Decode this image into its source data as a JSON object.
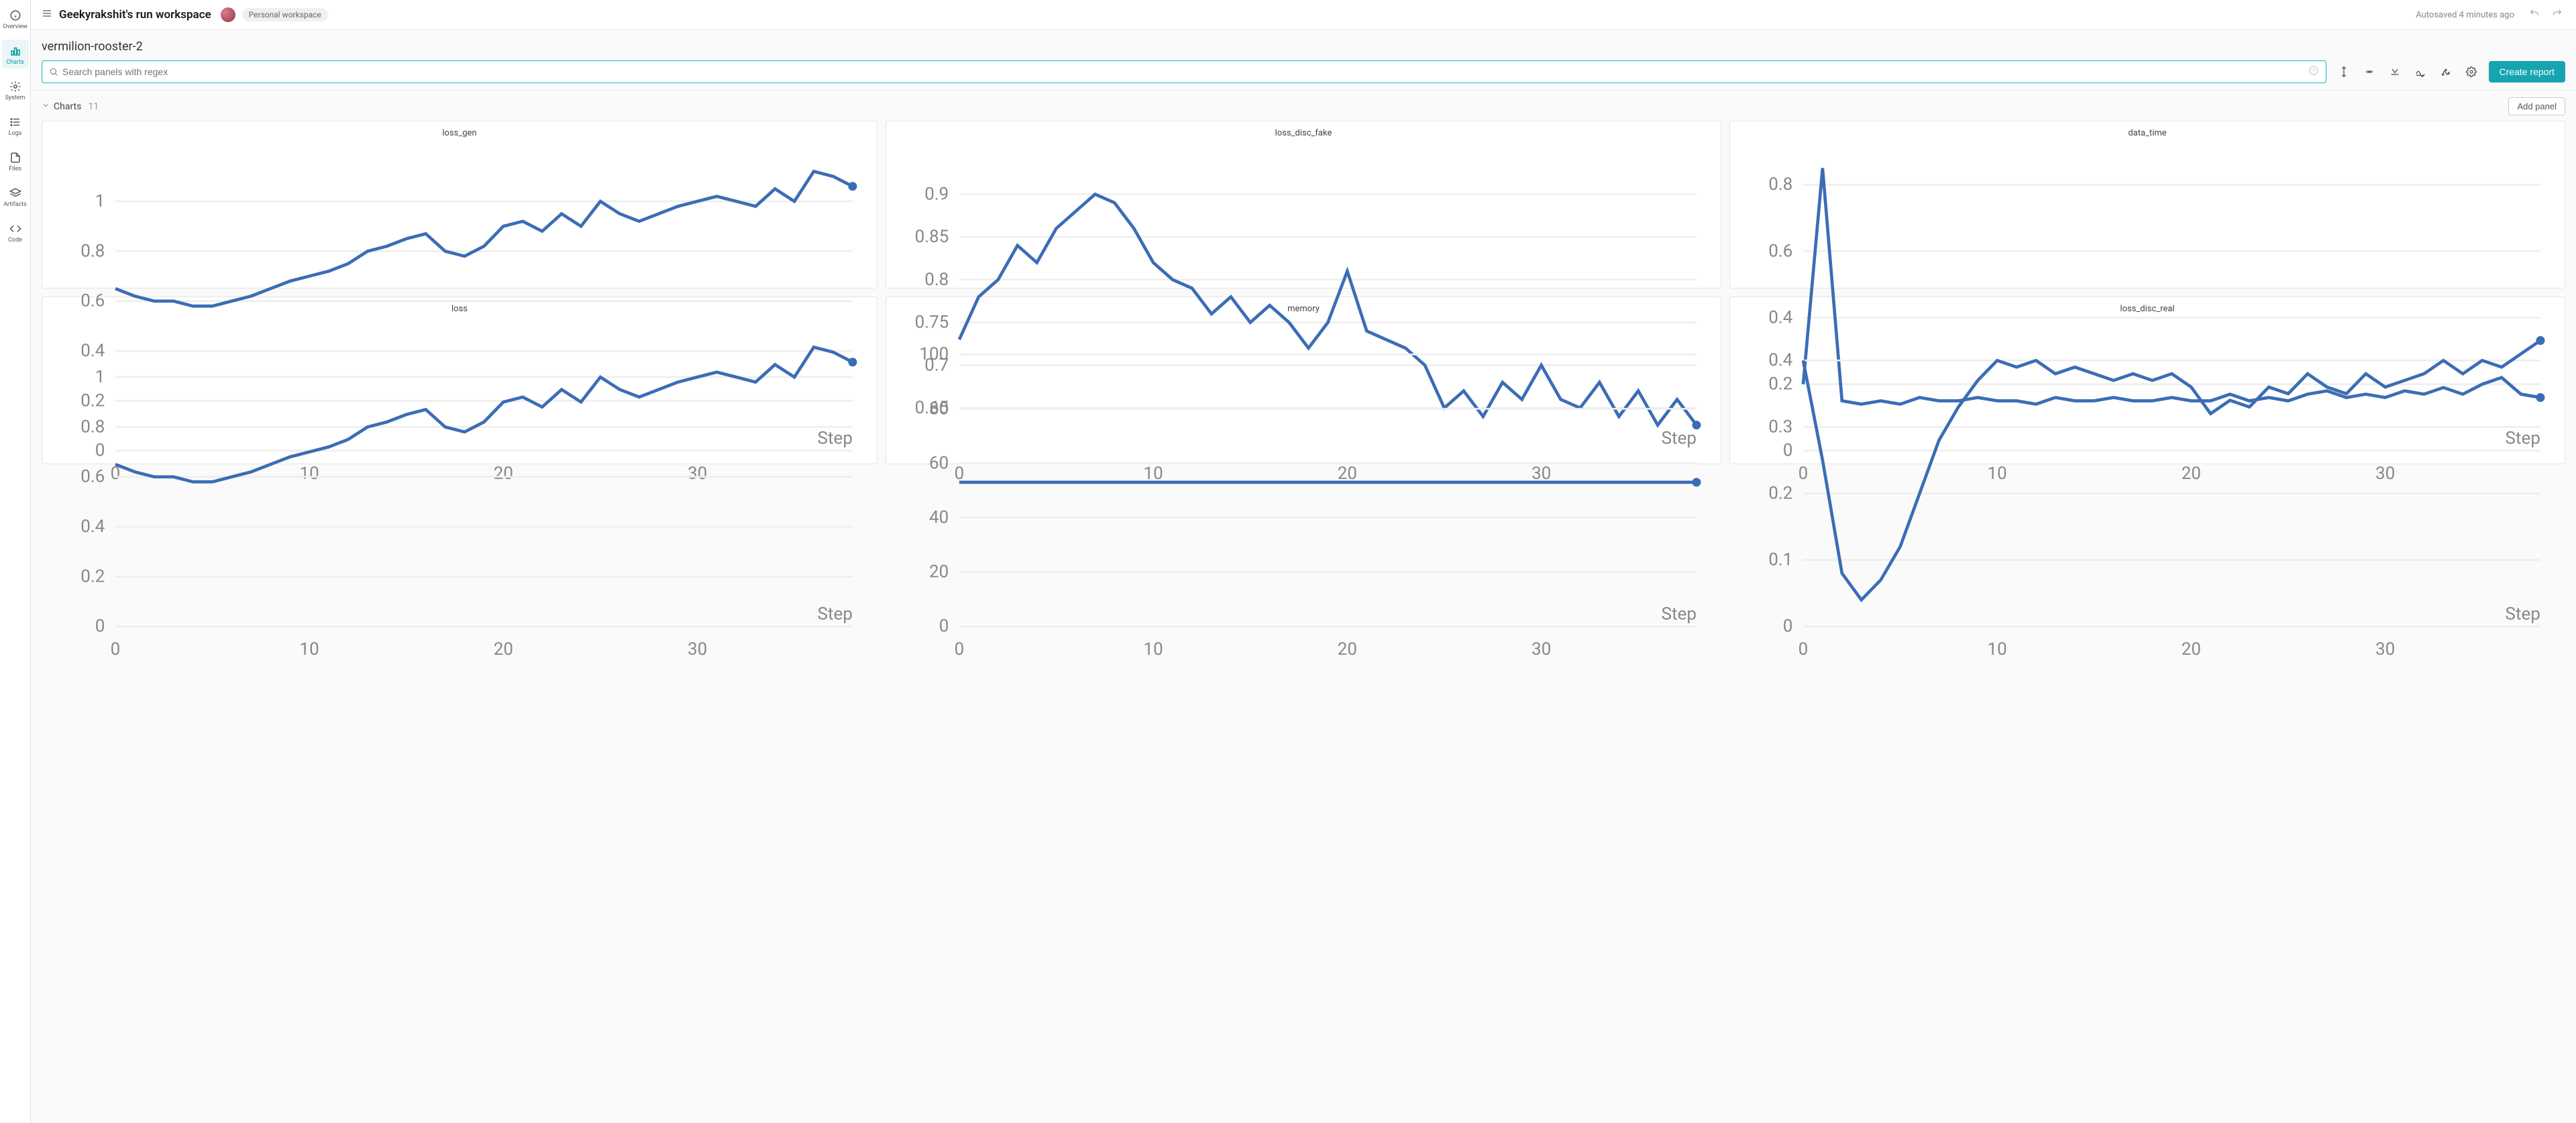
{
  "sidebar": {
    "items": [
      {
        "label": "Overview",
        "icon": "info"
      },
      {
        "label": "Charts",
        "icon": "bar",
        "active": true
      },
      {
        "label": "System",
        "icon": "gear"
      },
      {
        "label": "Logs",
        "icon": "list"
      },
      {
        "label": "Files",
        "icon": "file"
      },
      {
        "label": "Artifacts",
        "icon": "stack"
      },
      {
        "label": "Code",
        "icon": "code"
      }
    ]
  },
  "header": {
    "title": "Geekyrakshit's run workspace",
    "workspace_badge": "Personal workspace",
    "autosave": "Autosaved 4 minutes ago"
  },
  "run_name": "vermilion-rooster-2",
  "search": {
    "placeholder": "Search panels with regex"
  },
  "buttons": {
    "create_report": "Create report",
    "add_panel": "Add panel"
  },
  "section": {
    "name": "Charts",
    "count": "11"
  },
  "chart_data": [
    {
      "title": "loss_gen",
      "type": "line",
      "xlabel": "Step",
      "x_ticks": [
        0,
        10,
        20,
        30
      ],
      "y_ticks": [
        0,
        0.2,
        0.4,
        0.6,
        0.8,
        1
      ],
      "ylim": [
        0,
        1.2
      ],
      "x": [
        0,
        1,
        2,
        3,
        4,
        5,
        6,
        7,
        8,
        9,
        10,
        11,
        12,
        13,
        14,
        15,
        16,
        17,
        18,
        19,
        20,
        21,
        22,
        23,
        24,
        25,
        26,
        27,
        28,
        29,
        30,
        31,
        32,
        33,
        34,
        35,
        36,
        37,
        38
      ],
      "values": [
        0.65,
        0.62,
        0.6,
        0.6,
        0.58,
        0.58,
        0.6,
        0.62,
        0.65,
        0.68,
        0.7,
        0.72,
        0.75,
        0.8,
        0.82,
        0.85,
        0.87,
        0.8,
        0.78,
        0.82,
        0.9,
        0.92,
        0.88,
        0.95,
        0.9,
        1.0,
        0.95,
        0.92,
        0.95,
        0.98,
        1.0,
        1.02,
        1.0,
        0.98,
        1.05,
        1.0,
        1.12,
        1.1,
        1.06
      ]
    },
    {
      "title": "loss_disc_fake",
      "type": "line",
      "xlabel": "Step",
      "x_ticks": [
        0,
        10,
        20,
        30
      ],
      "y_ticks": [
        0.65,
        0.7,
        0.75,
        0.8,
        0.85,
        0.9
      ],
      "ylim": [
        0.6,
        0.95
      ],
      "x": [
        0,
        1,
        2,
        3,
        4,
        5,
        6,
        7,
        8,
        9,
        10,
        11,
        12,
        13,
        14,
        15,
        16,
        17,
        18,
        19,
        20,
        21,
        22,
        23,
        24,
        25,
        26,
        27,
        28,
        29,
        30,
        31,
        32,
        33,
        34,
        35,
        36,
        37,
        38
      ],
      "values": [
        0.73,
        0.78,
        0.8,
        0.84,
        0.82,
        0.86,
        0.88,
        0.9,
        0.89,
        0.86,
        0.82,
        0.8,
        0.79,
        0.76,
        0.78,
        0.75,
        0.77,
        0.75,
        0.72,
        0.75,
        0.81,
        0.74,
        0.73,
        0.72,
        0.7,
        0.65,
        0.67,
        0.64,
        0.68,
        0.66,
        0.7,
        0.66,
        0.65,
        0.68,
        0.64,
        0.67,
        0.63,
        0.66,
        0.63
      ]
    },
    {
      "title": "data_time",
      "type": "line",
      "xlabel": "Step",
      "x_ticks": [
        0,
        10,
        20,
        30
      ],
      "y_ticks": [
        0,
        0.2,
        0.4,
        0.6,
        0.8
      ],
      "ylim": [
        0,
        0.9
      ],
      "x": [
        0,
        1,
        2,
        3,
        4,
        5,
        6,
        7,
        8,
        9,
        10,
        11,
        12,
        13,
        14,
        15,
        16,
        17,
        18,
        19,
        20,
        21,
        22,
        23,
        24,
        25,
        26,
        27,
        28,
        29,
        30,
        31,
        32,
        33,
        34,
        35,
        36,
        37,
        38
      ],
      "values": [
        0.2,
        0.85,
        0.15,
        0.14,
        0.15,
        0.14,
        0.16,
        0.15,
        0.15,
        0.16,
        0.15,
        0.15,
        0.14,
        0.16,
        0.15,
        0.15,
        0.16,
        0.15,
        0.15,
        0.16,
        0.15,
        0.15,
        0.17,
        0.15,
        0.16,
        0.15,
        0.17,
        0.18,
        0.16,
        0.17,
        0.16,
        0.18,
        0.17,
        0.19,
        0.17,
        0.2,
        0.22,
        0.17,
        0.16
      ]
    },
    {
      "title": "loss",
      "type": "line",
      "xlabel": "Step",
      "x_ticks": [
        0,
        10,
        20,
        30
      ],
      "y_ticks": [
        0,
        0.2,
        0.4,
        0.6,
        0.8,
        1
      ],
      "ylim": [
        0,
        1.2
      ],
      "x": [
        0,
        1,
        2,
        3,
        4,
        5,
        6,
        7,
        8,
        9,
        10,
        11,
        12,
        13,
        14,
        15,
        16,
        17,
        18,
        19,
        20,
        21,
        22,
        23,
        24,
        25,
        26,
        27,
        28,
        29,
        30,
        31,
        32,
        33,
        34,
        35,
        36,
        37,
        38
      ],
      "values": [
        0.65,
        0.62,
        0.6,
        0.6,
        0.58,
        0.58,
        0.6,
        0.62,
        0.65,
        0.68,
        0.7,
        0.72,
        0.75,
        0.8,
        0.82,
        0.85,
        0.87,
        0.8,
        0.78,
        0.82,
        0.9,
        0.92,
        0.88,
        0.95,
        0.9,
        1.0,
        0.95,
        0.92,
        0.95,
        0.98,
        1.0,
        1.02,
        1.0,
        0.98,
        1.05,
        1.0,
        1.12,
        1.1,
        1.06
      ]
    },
    {
      "title": "memory",
      "type": "line",
      "xlabel": "Step",
      "x_ticks": [
        0,
        10,
        20,
        30
      ],
      "y_ticks": [
        0,
        20,
        40,
        60,
        80,
        100
      ],
      "ylim": [
        0,
        110
      ],
      "x": [
        0,
        38
      ],
      "values": [
        53,
        53
      ]
    },
    {
      "title": "loss_disc_real",
      "type": "line",
      "xlabel": "Step",
      "x_ticks": [
        0,
        10,
        20,
        30
      ],
      "y_ticks": [
        0,
        0.1,
        0.2,
        0.3,
        0.4
      ],
      "ylim": [
        0,
        0.45
      ],
      "x": [
        0,
        1,
        2,
        3,
        4,
        5,
        6,
        7,
        8,
        9,
        10,
        11,
        12,
        13,
        14,
        15,
        16,
        17,
        18,
        19,
        20,
        21,
        22,
        23,
        24,
        25,
        26,
        27,
        28,
        29,
        30,
        31,
        32,
        33,
        34,
        35,
        36,
        37,
        38
      ],
      "values": [
        0.4,
        0.25,
        0.08,
        0.04,
        0.07,
        0.12,
        0.2,
        0.28,
        0.33,
        0.37,
        0.4,
        0.39,
        0.4,
        0.38,
        0.39,
        0.38,
        0.37,
        0.38,
        0.37,
        0.38,
        0.36,
        0.32,
        0.34,
        0.33,
        0.36,
        0.35,
        0.38,
        0.36,
        0.35,
        0.38,
        0.36,
        0.37,
        0.38,
        0.4,
        0.38,
        0.4,
        0.39,
        0.41,
        0.43
      ]
    }
  ]
}
